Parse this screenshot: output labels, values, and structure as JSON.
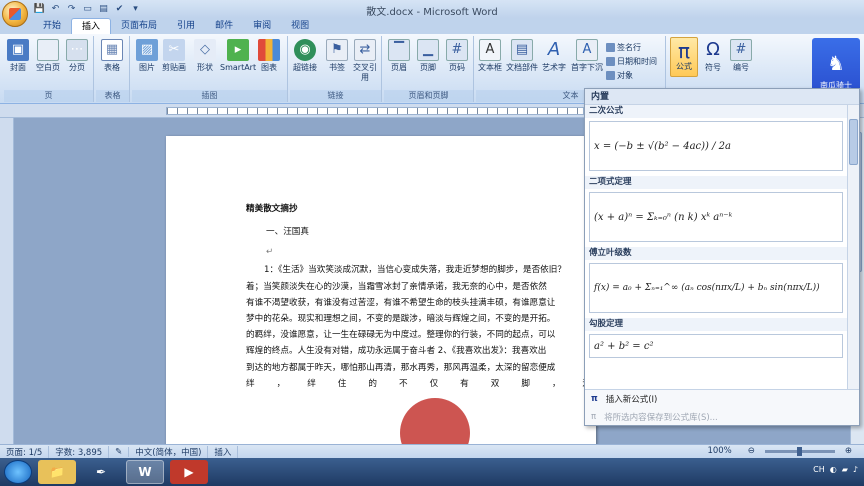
{
  "window": {
    "title": "散文.docx - Microsoft Word"
  },
  "tabs": [
    "开始",
    "插入",
    "页面布局",
    "引用",
    "邮件",
    "审阅",
    "视图"
  ],
  "active_tab": "插入",
  "ribbon": {
    "groups": {
      "pages": {
        "label": "页",
        "buttons": [
          "封面",
          "空白页",
          "分页"
        ]
      },
      "tables": {
        "label": "表格",
        "buttons": [
          "表格"
        ]
      },
      "illustrations": {
        "label": "插图",
        "buttons": [
          "图片",
          "剪贴画",
          "形状",
          "SmartArt",
          "图表"
        ]
      },
      "links": {
        "label": "链接",
        "buttons": [
          "超链接",
          "书签",
          "交叉引用"
        ]
      },
      "header_footer": {
        "label": "页眉和页脚",
        "buttons": [
          "页眉",
          "页脚",
          "页码"
        ]
      },
      "text": {
        "label": "文本",
        "buttons": [
          "文本框",
          "文档部件",
          "艺术字",
          "首字下沉"
        ],
        "small": [
          "签名行",
          "日期和时间",
          "对象"
        ]
      },
      "symbols": {
        "buttons": [
          "公式",
          "符号",
          "编号"
        ]
      }
    }
  },
  "logo": {
    "text": "南瓜骑士"
  },
  "document": {
    "title": "精美散文摘抄",
    "subtitle": "一、汪国真",
    "mark": "↵",
    "lines": [
      "1：《生活》当欢笑淡成沉默，当信心变成失落，我走近梦想的脚步，是否依旧？",
      "着；当笑颜淡失在心的沙漠，当霜雪冰封了亲情承诺，我无奈的心中，是否依然",
      "有谁不渴望收获，有谁没有过苦涩，有谁不希望生命的枝头挂满丰硕，有谁愿意让",
      "梦中的花朵。现实和理想之间，不变的是跋涉，暗淡与辉煌之间，不变的是开拓。",
      "的羁绊，没谁愿意，让一生在碌碌无为中度过。整理你的行装，不同的起点，可以",
      "辉煌的终点。人生没有对错，成功永远属于奋斗者 2、《我喜欢出发》：我喜欢出",
      "到达的地方都属于昨天，哪怕那山再清，那水再秀，那风再温柔，太深的留恋便成"
    ],
    "last_line": "绊，绊住的不仅有双脚，还有未"
  },
  "equation_panel": {
    "header": "内置",
    "items": [
      {
        "category": "二次公式",
        "formula": "x = (−b ± √(b² − 4ac)) / 2a"
      },
      {
        "category": "二项式定理",
        "formula": "(x + a)ⁿ = Σₖ₌₀ⁿ (n k) xᵏ aⁿ⁻ᵏ"
      },
      {
        "category": "傅立叶级数",
        "formula": "f(x) = a₀ + Σₙ₌₁^∞ (aₙ cos(nπx/L) + bₙ sin(nπx/L))"
      },
      {
        "category": "勾股定理",
        "formula": "a² + b² = c²"
      }
    ],
    "footer": {
      "insert_new": "插入新公式(I)",
      "save_selection": "将所选内容保存到公式库(S)..."
    }
  },
  "status": {
    "page": "页面: 1/5",
    "words": "字数: 3,895",
    "language": "中文(简体，中国)",
    "mode": "插入",
    "zoom": "100%"
  },
  "tray": {
    "lang": "CH"
  }
}
